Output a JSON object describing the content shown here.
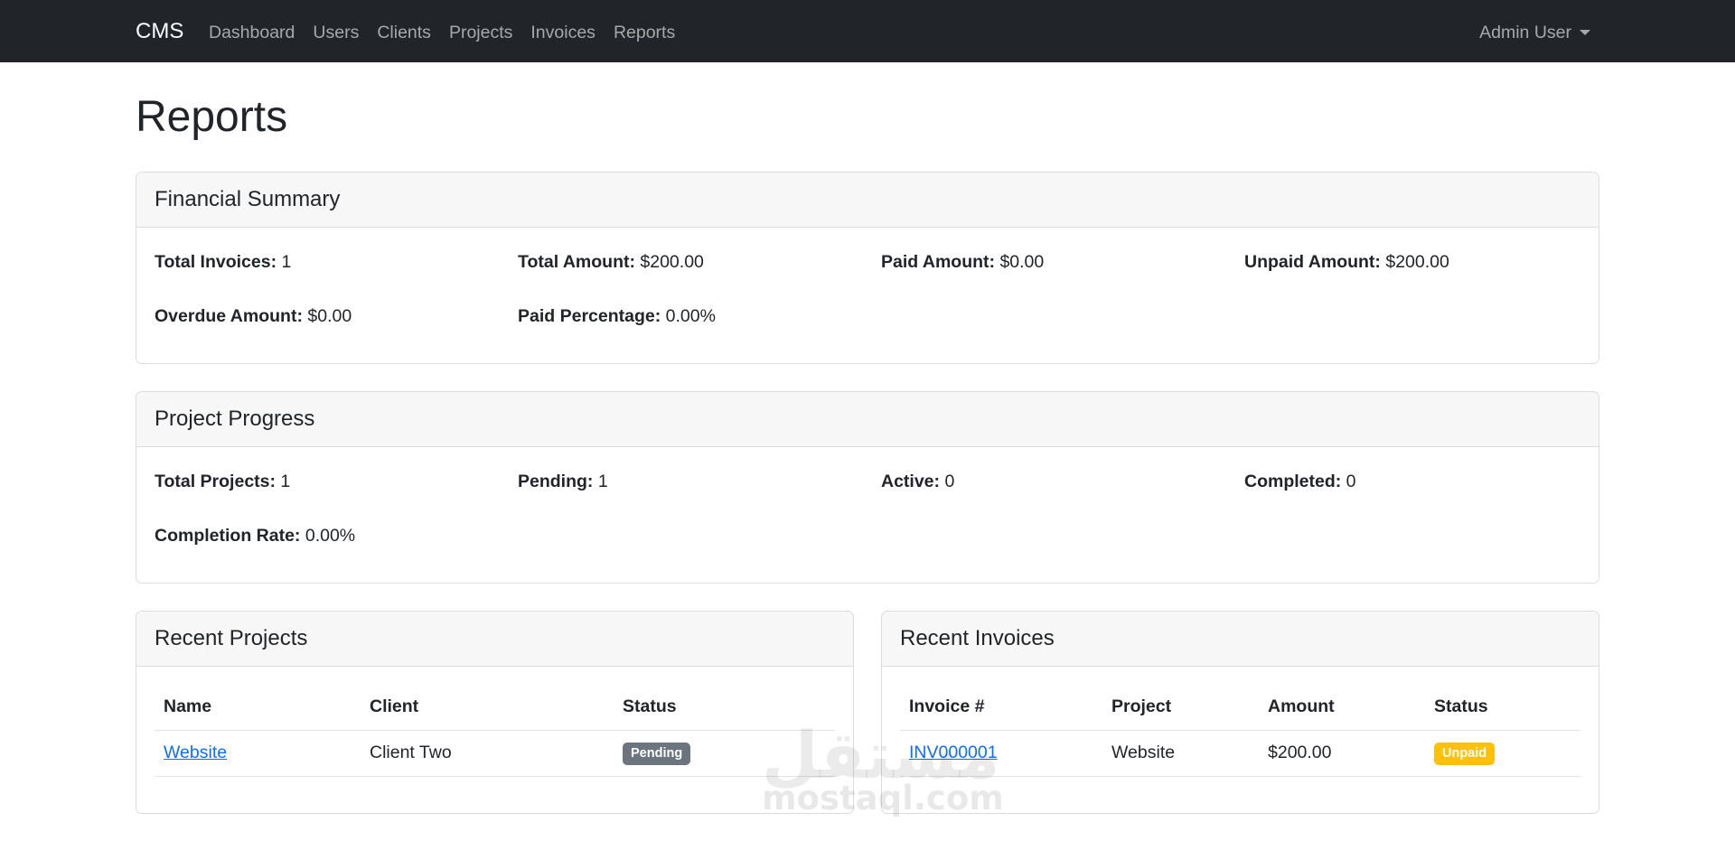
{
  "navbar": {
    "brand": "CMS",
    "links": [
      "Dashboard",
      "Users",
      "Clients",
      "Projects",
      "Invoices",
      "Reports"
    ],
    "user": "Admin User"
  },
  "page": {
    "title": "Reports"
  },
  "financial_summary": {
    "title": "Financial Summary",
    "stats": [
      {
        "label": "Total Invoices:",
        "value": "1"
      },
      {
        "label": "Total Amount:",
        "value": "$200.00"
      },
      {
        "label": "Paid Amount:",
        "value": "$0.00"
      },
      {
        "label": "Unpaid Amount:",
        "value": "$200.00"
      },
      {
        "label": "Overdue Amount:",
        "value": "$0.00"
      },
      {
        "label": "Paid Percentage:",
        "value": "0.00%"
      }
    ]
  },
  "project_progress": {
    "title": "Project Progress",
    "stats": [
      {
        "label": "Total Projects:",
        "value": "1"
      },
      {
        "label": "Pending:",
        "value": "1"
      },
      {
        "label": "Active:",
        "value": "0"
      },
      {
        "label": "Completed:",
        "value": "0"
      },
      {
        "label": "Completion Rate:",
        "value": "0.00%"
      }
    ]
  },
  "recent_projects": {
    "title": "Recent Projects",
    "columns": [
      "Name",
      "Client",
      "Status"
    ],
    "rows": [
      {
        "name": "Website",
        "client": "Client Two",
        "status": "Pending"
      }
    ]
  },
  "recent_invoices": {
    "title": "Recent Invoices",
    "columns": [
      "Invoice #",
      "Project",
      "Amount",
      "Status"
    ],
    "rows": [
      {
        "invoice": "INV000001",
        "project": "Website",
        "amount": "$200.00",
        "status": "Unpaid"
      }
    ]
  },
  "watermark": {
    "arabic": "مستقل",
    "latin": "mostaql.com"
  },
  "colors": {
    "navbar_bg": "#212529",
    "link": "#0d6efd",
    "badge_pending": "#6c757d",
    "badge_unpaid": "#ffc107"
  }
}
